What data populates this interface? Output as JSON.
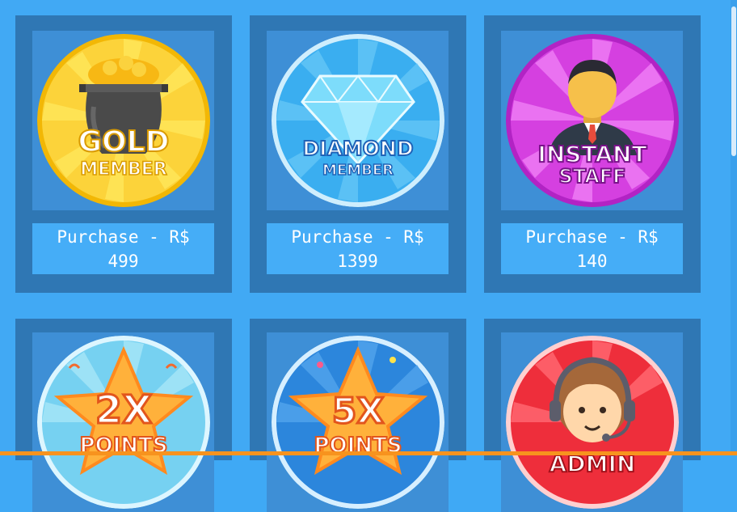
{
  "shop": {
    "items": [
      {
        "badge_line1": "GOLD",
        "badge_line2": "MEMBER",
        "purchase_label": "Purchase  - R$",
        "price": "499",
        "badge_icon": "gold-pot-icon",
        "color": "#f9c623"
      },
      {
        "badge_line1": "DIAMOND",
        "badge_line2": "MEMBER",
        "purchase_label": "Purchase  - R$",
        "price": "1399",
        "badge_icon": "diamond-icon",
        "color": "#3fb3f2"
      },
      {
        "badge_line1": "INSTANT",
        "badge_line2": "STAFF",
        "purchase_label": "Purchase  - R$",
        "price": "140",
        "badge_icon": "staff-person-icon",
        "color": "#d53fdc"
      },
      {
        "badge_line1": "2X",
        "badge_line2": "POINTS",
        "badge_icon": "star-icon",
        "color": "#7fd8f2"
      },
      {
        "badge_line1": "5X",
        "badge_line2": "POINTS",
        "badge_icon": "star-icon",
        "color": "#2f8ae0"
      },
      {
        "badge_line1": "ADMIN",
        "badge_line2": "",
        "badge_icon": "headset-person-icon",
        "color": "#ef2f3c"
      }
    ]
  }
}
